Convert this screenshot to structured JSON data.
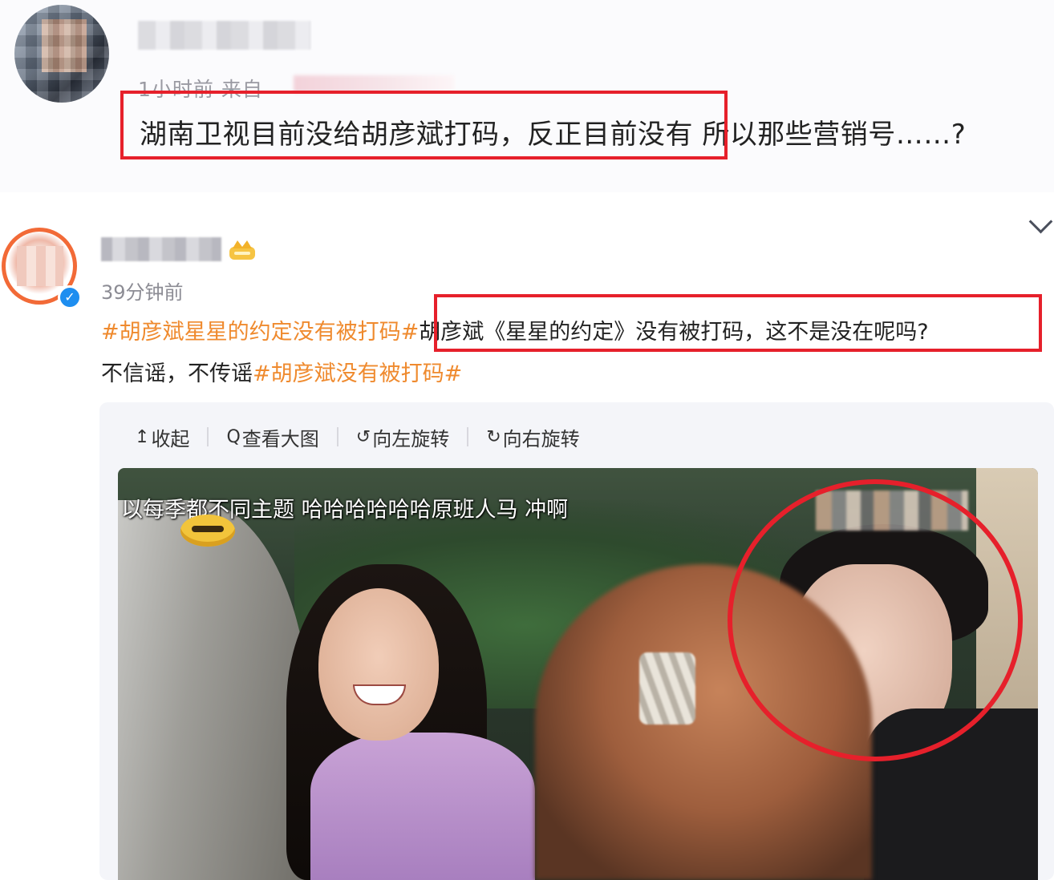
{
  "post1": {
    "meta": "1小时前 来自",
    "text_highlighted": "湖南卫视目前没给胡彦斌打码，反正目前没有",
    "text_rest": "所以那些营销号……?"
  },
  "post2": {
    "time": "39分钟前",
    "hashtag1": "#胡彦斌星星的约定没有被打码#",
    "highlighted": "胡彦斌《星星的约定》没有被打码，这不是没在呢吗?",
    "line2_text": "不信谣，不传谣",
    "hashtag2": "#胡彦斌没有被打码#",
    "verified_icon": "verified-badge-icon"
  },
  "viewer": {
    "toolbar": [
      {
        "icon": "collapse-up-icon",
        "glyph": "↥",
        "label": "收起"
      },
      {
        "icon": "search-icon",
        "glyph": "Q",
        "label": "查看大图"
      },
      {
        "icon": "rotate-left-icon",
        "glyph": "↺",
        "label": "向左旋转"
      },
      {
        "icon": "rotate-right-icon",
        "glyph": "↻",
        "label": "向右旋转"
      }
    ],
    "subtitle": "以每季都不同主题 哈哈哈哈哈哈原班人马 冲啊"
  },
  "colors": {
    "highlight_red": "#e6202b",
    "hashtag_orange": "#ef8a2e",
    "verified_blue": "#1e8ef0"
  }
}
